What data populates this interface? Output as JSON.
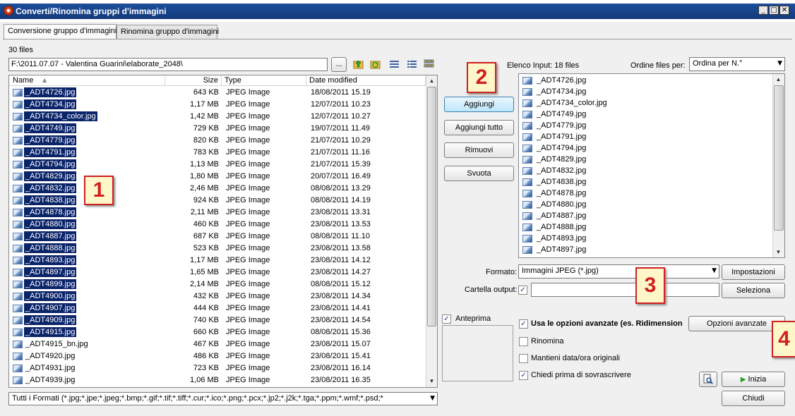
{
  "window": {
    "title": "Converti/Rinomina gruppi d'immagini"
  },
  "tabs": [
    {
      "label": "Conversione gruppo d'immagini",
      "active": true
    },
    {
      "label": "Rinomina gruppo d'immagini",
      "active": false
    }
  ],
  "browser": {
    "file_count": "30 files",
    "path": "F:\\2011.07.07 - Valentina Guarini\\elaborate_2048\\",
    "browse_label": "...",
    "columns": [
      "Name",
      "Size",
      "Type",
      "Date modified"
    ],
    "files": [
      {
        "name": "_ADT4726.jpg",
        "size": "643 KB",
        "type": "JPEG Image",
        "date": "18/08/2011 15.19",
        "selected": true
      },
      {
        "name": "_ADT4734.jpg",
        "size": "1,17 MB",
        "type": "JPEG Image",
        "date": "12/07/2011 10.23",
        "selected": true
      },
      {
        "name": "_ADT4734_color.jpg",
        "size": "1,42 MB",
        "type": "JPEG Image",
        "date": "12/07/2011 10.27",
        "selected": true
      },
      {
        "name": "_ADT4749.jpg",
        "size": "729 KB",
        "type": "JPEG Image",
        "date": "19/07/2011 11.49",
        "selected": true
      },
      {
        "name": "_ADT4779.jpg",
        "size": "820 KB",
        "type": "JPEG Image",
        "date": "21/07/2011 10.29",
        "selected": true
      },
      {
        "name": "_ADT4791.jpg",
        "size": "783 KB",
        "type": "JPEG Image",
        "date": "21/07/2011 11.16",
        "selected": true
      },
      {
        "name": "_ADT4794.jpg",
        "size": "1,13 MB",
        "type": "JPEG Image",
        "date": "21/07/2011 15.39",
        "selected": true
      },
      {
        "name": "_ADT4829.jpg",
        "size": "1,80 MB",
        "type": "JPEG Image",
        "date": "20/07/2011 16.49",
        "selected": true
      },
      {
        "name": "_ADT4832.jpg",
        "size": "2,46 MB",
        "type": "JPEG Image",
        "date": "08/08/2011 13.29",
        "selected": true
      },
      {
        "name": "_ADT4838.jpg",
        "size": "924 KB",
        "type": "JPEG Image",
        "date": "08/08/2011 14.19",
        "selected": true
      },
      {
        "name": "_ADT4878.jpg",
        "size": "2,11 MB",
        "type": "JPEG Image",
        "date": "23/08/2011 13.31",
        "selected": true
      },
      {
        "name": "_ADT4880.jpg",
        "size": "460 KB",
        "type": "JPEG Image",
        "date": "23/08/2011 13.53",
        "selected": true
      },
      {
        "name": "_ADT4887.jpg",
        "size": "687 KB",
        "type": "JPEG Image",
        "date": "08/08/2011 11.10",
        "selected": true
      },
      {
        "name": "_ADT4888.jpg",
        "size": "523 KB",
        "type": "JPEG Image",
        "date": "23/08/2011 13.58",
        "selected": true
      },
      {
        "name": "_ADT4893.jpg",
        "size": "1,17 MB",
        "type": "JPEG Image",
        "date": "23/08/2011 14.12",
        "selected": true
      },
      {
        "name": "_ADT4897.jpg",
        "size": "1,65 MB",
        "type": "JPEG Image",
        "date": "23/08/2011 14.27",
        "selected": true
      },
      {
        "name": "_ADT4899.jpg",
        "size": "2,14 MB",
        "type": "JPEG Image",
        "date": "08/08/2011 15.12",
        "selected": true
      },
      {
        "name": "_ADT4900.jpg",
        "size": "432 KB",
        "type": "JPEG Image",
        "date": "23/08/2011 14.34",
        "selected": true
      },
      {
        "name": "_ADT4907.jpg",
        "size": "444 KB",
        "type": "JPEG Image",
        "date": "23/08/2011 14.41",
        "selected": true
      },
      {
        "name": "_ADT4909.jpg",
        "size": "740 KB",
        "type": "JPEG Image",
        "date": "23/08/2011 14.54",
        "selected": true
      },
      {
        "name": "_ADT4915.jpg",
        "size": "660 KB",
        "type": "JPEG Image",
        "date": "08/08/2011 15.36",
        "selected": true
      },
      {
        "name": "_ADT4915_bn.jpg",
        "size": "467 KB",
        "type": "JPEG Image",
        "date": "23/08/2011 15.07",
        "selected": false
      },
      {
        "name": "_ADT4920.jpg",
        "size": "486 KB",
        "type": "JPEG Image",
        "date": "23/08/2011 15.41",
        "selected": false
      },
      {
        "name": "_ADT4931.jpg",
        "size": "723 KB",
        "type": "JPEG Image",
        "date": "23/08/2011 16.14",
        "selected": false
      },
      {
        "name": "_ADT4939.jpg",
        "size": "1,06 MB",
        "type": "JPEG Image",
        "date": "23/08/2011 16.35",
        "selected": false
      }
    ],
    "filter": "Tutti i Formati (*.jpg;*.jpe;*.jpeg;*.bmp;*.gif;*.tif;*.tiff;*.cur;*.ico;*.png;*.pcx;*.jp2;*.j2k;*.tga;*.ppm;*.wmf;*.psd;*"
  },
  "actions": {
    "add": "Aggiungi",
    "add_all": "Aggiungi tutto",
    "remove": "Rimuovi",
    "clear": "Svuota"
  },
  "input_list": {
    "label": "Elenco Input:",
    "count": "18 files",
    "sort_label": "Ordine files per:",
    "sort_value": "Ordina per N.°",
    "files": [
      "_ADT4726.jpg",
      "_ADT4734.jpg",
      "_ADT4734_color.jpg",
      "_ADT4749.jpg",
      "_ADT4779.jpg",
      "_ADT4791.jpg",
      "_ADT4794.jpg",
      "_ADT4829.jpg",
      "_ADT4832.jpg",
      "_ADT4838.jpg",
      "_ADT4878.jpg",
      "_ADT4880.jpg",
      "_ADT4887.jpg",
      "_ADT4888.jpg",
      "_ADT4893.jpg",
      "_ADT4897.jpg"
    ]
  },
  "output": {
    "format_label": "Formato:",
    "format_value": "Immagini JPEG (*.jpg)",
    "settings_button": "Impostazioni",
    "folder_label": "Cartella output:",
    "folder_value": "",
    "select_button": "Seleziona"
  },
  "preview": {
    "label": "Anteprima",
    "checked": true
  },
  "options": {
    "advanced_label": "Usa le opzioni avanzate (es. Ridimension",
    "advanced_button": "Opzioni avanzate",
    "rename_label": "Rinomina",
    "keep_date_label": "Mantieni data/ora originali",
    "ask_overwrite_label": "Chiedi prima di sovrascrivere",
    "start_button": "Inizia",
    "close_button": "Chiudi"
  },
  "callouts": [
    "1",
    "2",
    "3",
    "4"
  ],
  "colors": {
    "title_bar": "#1c4f9c",
    "selection": "#0a246a",
    "callout_border": "#d02020",
    "callout_fill": "#fff7c9",
    "start_arrow": "#1fa51f"
  }
}
